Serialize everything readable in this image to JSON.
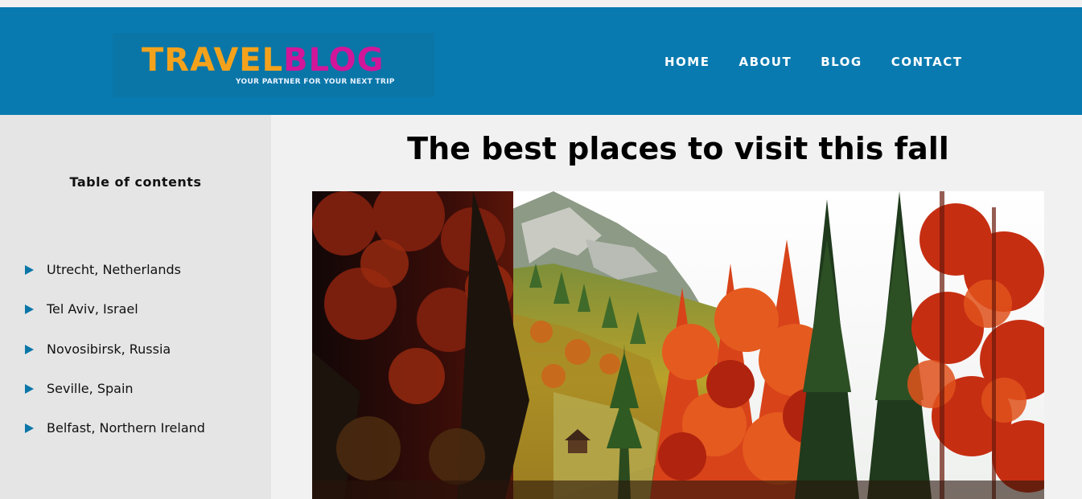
{
  "logo": {
    "travel": "TRAVEL",
    "blog": "BLOG",
    "tagline": "YOUR PARTNER FOR YOUR NEXT TRIP"
  },
  "nav": {
    "home": "HOME",
    "about": "ABOUT",
    "blog": "BLOG",
    "contact": "CONTACT"
  },
  "sidebar": {
    "title": "Table of contents",
    "items": [
      {
        "label": "Utrecht, Netherlands"
      },
      {
        "label": "Tel Aviv, Israel"
      },
      {
        "label": "Novosibirsk, Russia"
      },
      {
        "label": "Seville, Spain"
      },
      {
        "label": "Belfast, Northern Ireland"
      }
    ]
  },
  "main": {
    "title": "The best places to visit this fall"
  },
  "colors": {
    "header": "#087ab0",
    "logo_travel": "#f4a21c",
    "logo_blog": "#d1169a",
    "sidebar_bg": "#e5e5e5",
    "toc_arrow": "#0a76a8"
  },
  "icons": {
    "toc_bullet": "triangle-right-icon"
  }
}
